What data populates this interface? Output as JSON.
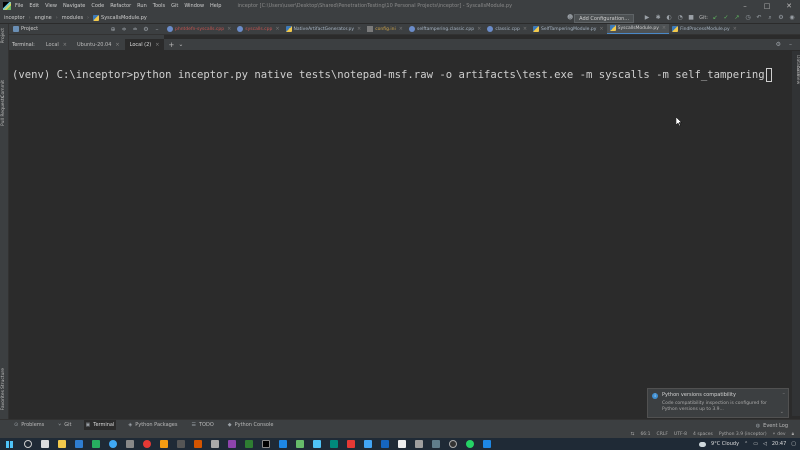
{
  "window": {
    "title": "inceptor [C:\\Users\\user\\Desktop\\Shared\\PenetrationTesting\\10 Personal Projects\\inceptor] - SyscallsModule.py",
    "menu": [
      "File",
      "Edit",
      "View",
      "Navigate",
      "Code",
      "Refactor",
      "Run",
      "Tools",
      "Git",
      "Window",
      "Help"
    ]
  },
  "navbar": {
    "breadcrumb": [
      "inceptor",
      "engine",
      "modules"
    ],
    "file": "SyscallsModule.py",
    "run_config": "Add Configuration...",
    "git": "Git:"
  },
  "project": {
    "label": "Project"
  },
  "editor_tabs": [
    {
      "label": "phntdefn-syscalls.cpp",
      "icon": "cpp",
      "color": "#c75450"
    },
    {
      "label": "syscalls.cpp",
      "icon": "cpp",
      "color": "#c75450"
    },
    {
      "label": "NativeArtifactGenerator.py",
      "icon": "py",
      "color": "#a9b7c6"
    },
    {
      "label": "config.ini",
      "icon": "ini",
      "color": "#d0a54a"
    },
    {
      "label": "selftampering.classic.cpp",
      "icon": "cpp",
      "color": "#a9b7c6"
    },
    {
      "label": "classic.cpp",
      "icon": "cpp",
      "color": "#a9b7c6"
    },
    {
      "label": "SelfTamperingModule.py",
      "icon": "py",
      "color": "#a9b7c6"
    },
    {
      "label": "SyscallsModule.py",
      "icon": "py",
      "color": "#cfcfcf",
      "active": true
    },
    {
      "label": "FindProcessModule.py",
      "icon": "py",
      "color": "#a9b7c6"
    }
  ],
  "terminal": {
    "title": "Terminal:",
    "tabs": [
      {
        "label": "Local"
      },
      {
        "label": "Ubuntu-20.04"
      },
      {
        "label": "Local (2)",
        "active": true
      }
    ],
    "line": "(venv) C:\\inceptor>python inceptor.py native tests\\notepad-msf.raw -o artifacts\\test.exe -m syscalls -m self_tampering"
  },
  "left_strip": {
    "project": "Project",
    "commit": "Commit",
    "pull_requests": "Pull Requests",
    "favorites": "Favorites",
    "structure": "Structure"
  },
  "right_strip": {
    "database": "Database",
    "sciview": "SciView"
  },
  "notification": {
    "title": "Python versions compatibility",
    "body": "Code compatibility inspection is configured for Python versions up to 3.9..."
  },
  "bottom_tabs": [
    {
      "label": "Problems",
      "icon": "⊙"
    },
    {
      "label": "Git",
      "icon": "⑂"
    },
    {
      "label": "Terminal",
      "icon": "▣",
      "active": true
    },
    {
      "label": "Python Packages",
      "icon": "◈"
    },
    {
      "label": "TODO",
      "icon": "☰"
    },
    {
      "label": "Python Console",
      "icon": "◆"
    }
  ],
  "event_log": "Event Log",
  "statusbar": {
    "position": "66:1",
    "line_sep": "CRLF",
    "encoding": "UTF-8",
    "indent": "4 spaces",
    "interpreter": "Python 3.9 (inceptor)",
    "branch": "dev"
  },
  "taskbar": {
    "weather": "9°C Cloudy",
    "time": "20:47"
  },
  "colors": {
    "accent": "#4a88c7",
    "background": "#2b2b2b",
    "panel": "#3c3f41"
  }
}
